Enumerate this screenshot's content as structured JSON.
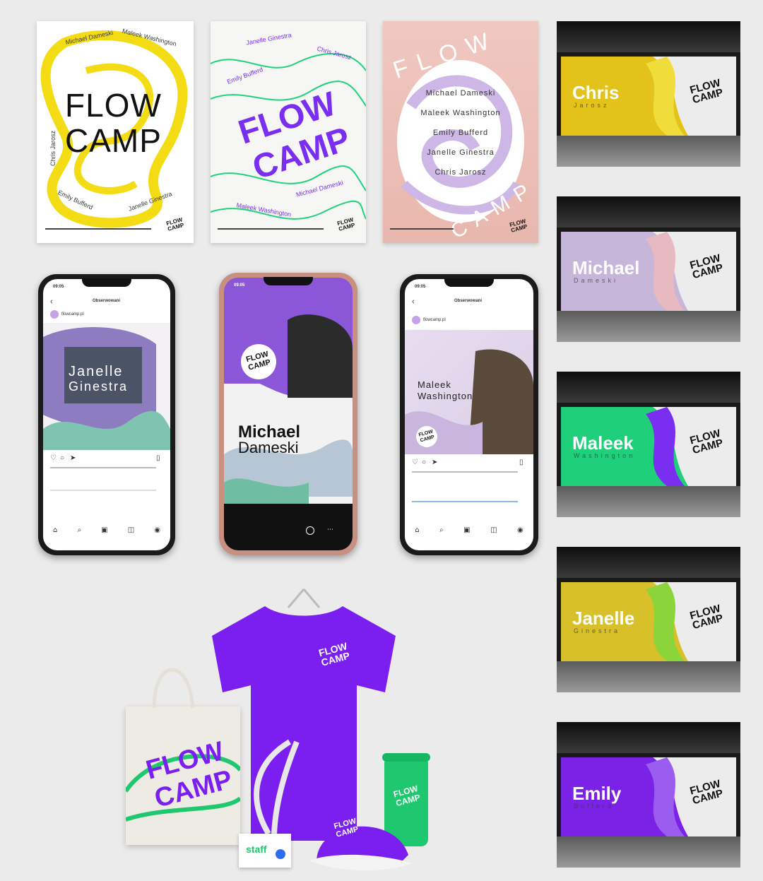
{
  "posters": {
    "yellow": {
      "title_line1": "FLOW",
      "title_line2": "CAMP",
      "names": [
        "Michael Dameski",
        "Maleek Washington",
        "Chris Jarosz",
        "Emily Bufferd",
        "Janelle Ginestra"
      ],
      "colors": {
        "bg": "#ffffff",
        "accent": "#f3dc14"
      }
    },
    "white": {
      "title_line1": "FLOW",
      "title_line2": "CAMP",
      "names": [
        "Janelle Ginestra",
        "Chris Jarosz",
        "Emily Bufferd",
        "Michael Dameski",
        "Maleek Washington"
      ],
      "colors": {
        "bg": "#f6f6f4",
        "accent": "#7a2ff0",
        "line": "#1fd37a"
      }
    },
    "pink": {
      "title_top": "FLOW",
      "title_bottom": "CAMP",
      "lineup": [
        "Michael Dameski",
        "Maleek Washington",
        "Emily Bufferd",
        "Janelle Ginestra",
        "Chris Jarosz"
      ],
      "colors": {
        "bg": "#eec3b8",
        "accent": "#cdb7e6"
      }
    },
    "logo": "FLOW CAMP"
  },
  "phones": {
    "left": {
      "time": "09:05",
      "header_title": "Obserwowani",
      "post_title_1": "Janelle",
      "post_title_2": "Ginestra",
      "username": "flowcamp.pl"
    },
    "middle": {
      "time": "09:05",
      "story_title_1": "Michael",
      "story_title_2": "Dameski",
      "logo": "FLOW CAMP"
    },
    "right": {
      "time": "09:05",
      "header_title": "Obserwowani",
      "post_title_1": "Maleek",
      "post_title_2": "Washington",
      "username": "flowcamp.pl",
      "logo": "FLOW CAMP"
    }
  },
  "billboards": [
    {
      "name": "Chris",
      "sub": "Jarosz",
      "color": "#e3c21a",
      "shape": "#f0dc3a"
    },
    {
      "name": "Michael",
      "sub": "Dameski",
      "color": "#c6b6d9",
      "shape": "#e7b9c1"
    },
    {
      "name": "Maleek",
      "sub": "Washington",
      "color": "#1fcf7a",
      "shape": "#7a2ff0"
    },
    {
      "name": "Janelle",
      "sub": "Ginestra",
      "color": "#d7c02a",
      "shape": "#8bd53a"
    },
    {
      "name": "Emily",
      "sub": "Bufferd",
      "color": "#7a22e6",
      "shape": "#9b5cf0"
    }
  ],
  "billboard_logo": "FLOW CAMP",
  "merch": {
    "tshirt_logo": "FLOW CAMP",
    "tote_logo_1": "FLOW",
    "tote_logo_2": "CAMP",
    "cup_logo": "FLOW CAMP",
    "cap_logo": "FLOW CAMP",
    "badge_text": "staff",
    "colors": {
      "purple": "#7b1ff0",
      "green": "#1fc86e",
      "tote": "#eeeae4"
    }
  }
}
